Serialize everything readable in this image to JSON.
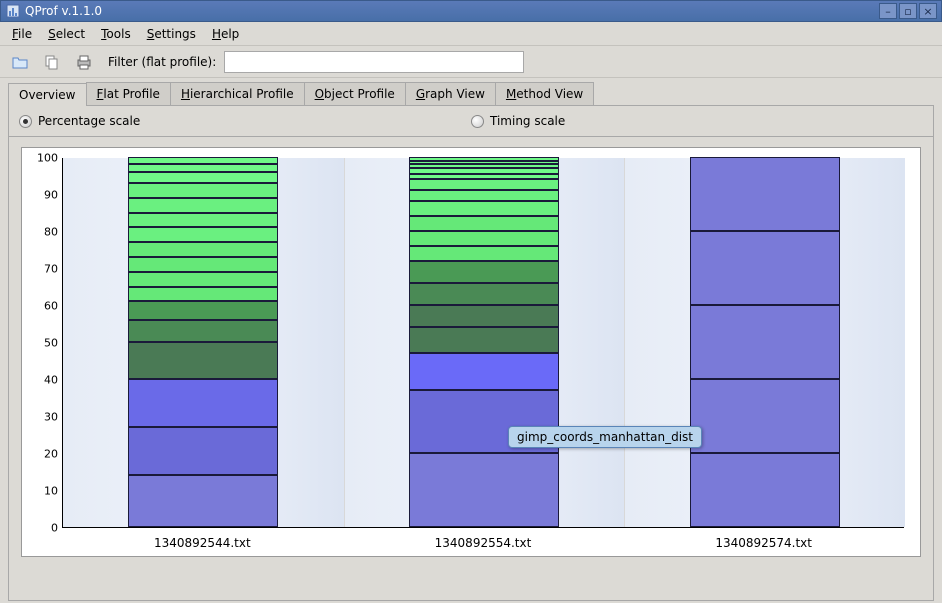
{
  "window": {
    "title": "QProf v.1.1.0"
  },
  "menu": {
    "file": "File",
    "select": "Select",
    "tools": "Tools",
    "settings": "Settings",
    "help": "Help"
  },
  "toolbar": {
    "filter_label": "Filter (flat profile):",
    "filter_value": ""
  },
  "tabs": {
    "items": [
      "Overview",
      "Flat Profile",
      "Hierarchical Profile",
      "Object Profile",
      "Graph View",
      "Method View"
    ],
    "active": 0
  },
  "scales": {
    "percentage": "Percentage scale",
    "timing": "Timing scale",
    "selected": "percentage"
  },
  "tooltip": {
    "text": "gimp_coords_manhattan_dist"
  },
  "chart_data": {
    "type": "bar",
    "stacked": true,
    "ylabel": "",
    "xlabel": "",
    "ylim": [
      0,
      100
    ],
    "yticks": [
      0,
      10,
      20,
      30,
      40,
      50,
      60,
      70,
      80,
      90,
      100
    ],
    "categories": [
      "1340892544.txt",
      "1340892554.txt",
      "1340892574.txt"
    ],
    "series_note": "Each stack sums to 100. Segments listed bottom→top per category with color.",
    "stacks": [
      [
        {
          "v": 14,
          "c": "#7a7ad8"
        },
        {
          "v": 13,
          "c": "#6a6ad8"
        },
        {
          "v": 13,
          "c": "#6a6ae8"
        },
        {
          "v": 10,
          "c": "#4a7a55"
        },
        {
          "v": 6,
          "c": "#4a8a55"
        },
        {
          "v": 5,
          "c": "#4a9a55"
        },
        {
          "v": 4,
          "c": "#65e878"
        },
        {
          "v": 4,
          "c": "#65e878"
        },
        {
          "v": 4,
          "c": "#65e878"
        },
        {
          "v": 4,
          "c": "#65e878"
        },
        {
          "v": 4,
          "c": "#6af080"
        },
        {
          "v": 4,
          "c": "#6af080"
        },
        {
          "v": 4,
          "c": "#6af080"
        },
        {
          "v": 4,
          "c": "#6af080"
        },
        {
          "v": 3,
          "c": "#70f888"
        },
        {
          "v": 2,
          "c": "#70f888"
        },
        {
          "v": 2,
          "c": "#70f888"
        }
      ],
      [
        {
          "v": 20,
          "c": "#7a7ad8"
        },
        {
          "v": 17,
          "c": "#6a6ad8"
        },
        {
          "v": 10,
          "c": "#6a6af8"
        },
        {
          "v": 7,
          "c": "#4a7a55"
        },
        {
          "v": 6,
          "c": "#4a7a55"
        },
        {
          "v": 6,
          "c": "#4a8a55"
        },
        {
          "v": 6,
          "c": "#4a9a55"
        },
        {
          "v": 4,
          "c": "#65e878"
        },
        {
          "v": 4,
          "c": "#65e878"
        },
        {
          "v": 4,
          "c": "#65e878"
        },
        {
          "v": 4,
          "c": "#6af080"
        },
        {
          "v": 3,
          "c": "#6af080"
        },
        {
          "v": 3,
          "c": "#6af080"
        },
        {
          "v": 1.5,
          "c": "#70f888"
        },
        {
          "v": 1.5,
          "c": "#70f888"
        },
        {
          "v": 1,
          "c": "#70f888"
        },
        {
          "v": 1,
          "c": "#70f888"
        },
        {
          "v": 1,
          "c": "#70f888"
        }
      ],
      [
        {
          "v": 20,
          "c": "#7a7ad8"
        },
        {
          "v": 20,
          "c": "#7a7ad8"
        },
        {
          "v": 20,
          "c": "#7a7ad8"
        },
        {
          "v": 20,
          "c": "#7a7ad8"
        },
        {
          "v": 20,
          "c": "#7a7ad8"
        }
      ]
    ]
  }
}
